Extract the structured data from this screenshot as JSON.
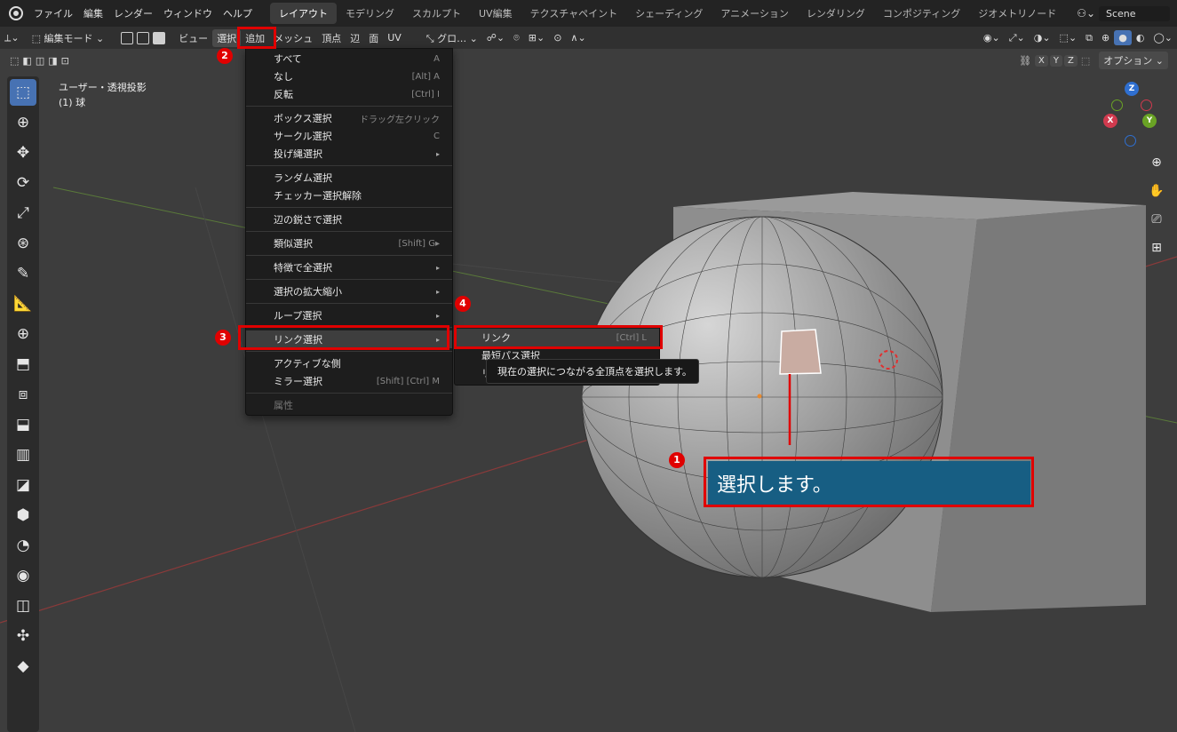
{
  "topbar": {
    "menus": [
      "ファイル",
      "編集",
      "レンダー",
      "ウィンドウ",
      "ヘルプ"
    ],
    "workspace_tabs": [
      "レイアウト",
      "モデリング",
      "スカルプト",
      "UV編集",
      "テクスチャペイント",
      "シェーディング",
      "アニメーション",
      "レンダリング",
      "コンポジティング",
      "ジオメトリノード"
    ],
    "active_tab": "レイアウト",
    "scene_name": "Scene"
  },
  "header": {
    "mode": "編集モード",
    "menus": [
      "ビュー",
      "選択",
      "追加",
      "メッシュ",
      "頂点",
      "辺",
      "面",
      "UV"
    ],
    "transform_orientation": "グロ…",
    "axis_labels": [
      "X",
      "Y",
      "Z"
    ],
    "options_label": "オプション"
  },
  "viewport": {
    "view_name": "ユーザー・透視投影",
    "object_name": "(1) 球",
    "gizmo": {
      "z": "Z",
      "y": "Y",
      "x": "X"
    }
  },
  "select_menu": {
    "items": [
      {
        "label": "すべて",
        "shortcut": "A"
      },
      {
        "label": "なし",
        "shortcut": "[Alt] A"
      },
      {
        "label": "反転",
        "shortcut": "[Ctrl] I"
      },
      {
        "label": "ボックス選択",
        "shortcut": "ドラッグ左クリック"
      },
      {
        "label": "サークル選択",
        "shortcut": "C"
      },
      {
        "label": "投げ縄選択",
        "shortcut": "▸"
      },
      {
        "label": "ランダム選択",
        "shortcut": ""
      },
      {
        "label": "チェッカー選択解除",
        "shortcut": ""
      },
      {
        "label": "辺の鋭さで選択",
        "shortcut": ""
      },
      {
        "label": "類似選択",
        "shortcut": "[Shift] G▸"
      },
      {
        "label": "特徴で全選択",
        "shortcut": "▸"
      },
      {
        "label": "選択の拡大縮小",
        "shortcut": "▸"
      },
      {
        "label": "ループ選択",
        "shortcut": "▸"
      },
      {
        "label": "リンク選択",
        "shortcut": "▸"
      },
      {
        "label": "アクティブな側",
        "shortcut": ""
      },
      {
        "label": "ミラー選択",
        "shortcut": "[Shift] [Ctrl] M"
      },
      {
        "label": "属性",
        "shortcut": ""
      }
    ]
  },
  "link_submenu": {
    "items": [
      {
        "label": "リンク",
        "shortcut": "[Ctrl] L"
      },
      {
        "label": "最短パス選択",
        "shortcut": ""
      },
      {
        "label": "リ",
        "shortcut": ""
      }
    ]
  },
  "tooltip": {
    "text": "現在の選択につながる全頂点を選択します。"
  },
  "annotations": {
    "badges": [
      "1",
      "2",
      "3",
      "4"
    ],
    "callout": "選択します。"
  },
  "colors": {
    "accent": "#4772b3",
    "annotation_red": "#e00000",
    "callout_bg": "#175e83"
  }
}
